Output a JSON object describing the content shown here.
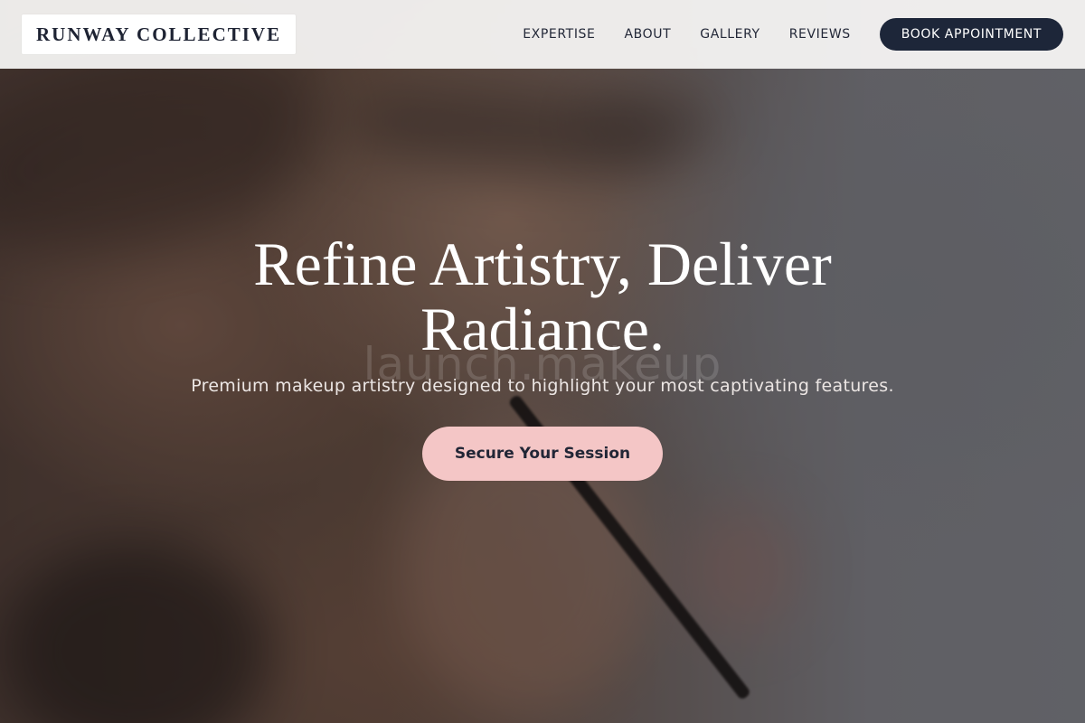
{
  "header": {
    "brand": "RUNWAY COLLECTIVE",
    "nav": [
      "EXPERTISE",
      "ABOUT",
      "GALLERY",
      "REVIEWS"
    ],
    "book_button": "BOOK APPOINTMENT"
  },
  "hero": {
    "headline": "Refine Artistry, Deliver Radiance.",
    "watermark": "launch.makeup",
    "subline": "Premium makeup artistry designed to highlight your most captivating features.",
    "cta": "Secure Your Session",
    "background_image": "close-up of makeup artist applying eyeliner with brush"
  },
  "colors": {
    "navy": "#1d2639",
    "pink": "#f4c6c6",
    "header_bg": "#f6f5f4"
  }
}
